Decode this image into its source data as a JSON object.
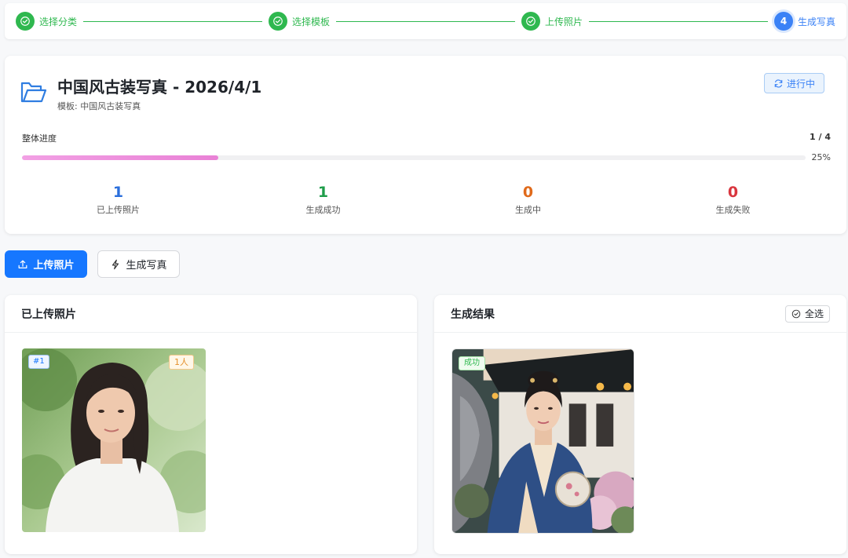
{
  "stepper": {
    "steps": [
      {
        "number": "1",
        "label": "选择分类",
        "state": "done"
      },
      {
        "number": "2",
        "label": "选择模板",
        "state": "done"
      },
      {
        "number": "3",
        "label": "上传照片",
        "state": "done"
      },
      {
        "number": "4",
        "label": "生成写真",
        "state": "active"
      }
    ]
  },
  "overview": {
    "title": "中国风古装写真 - 2026/4/1",
    "template_label": "模板: 中国风古装写真",
    "status": "进行中",
    "progress_label": "整体进度",
    "progress_count": "1 / 4",
    "progress_percent_text": "25%",
    "progress_fraction": 0.25,
    "stats": [
      {
        "value": "1",
        "label": "已上传照片",
        "color": "#2b6fdc"
      },
      {
        "value": "1",
        "label": "生成成功",
        "color": "#1f9d4a"
      },
      {
        "value": "0",
        "label": "生成中",
        "color": "#e06a1b"
      },
      {
        "value": "0",
        "label": "生成失败",
        "color": "#d9363e"
      }
    ]
  },
  "actions": {
    "upload_label": "上传照片",
    "generate_label": "生成写真"
  },
  "uploaded_panel": {
    "title": "已上传照片",
    "photo": {
      "index_tag": "#1",
      "people_tag": "1人"
    }
  },
  "results_panel": {
    "title": "生成结果",
    "select_all_label": "全选",
    "photo": {
      "status_tag": "成功"
    }
  },
  "colors": {
    "primary": "#1677ff",
    "success": "#2fb84f",
    "progress": "#e981d6"
  }
}
